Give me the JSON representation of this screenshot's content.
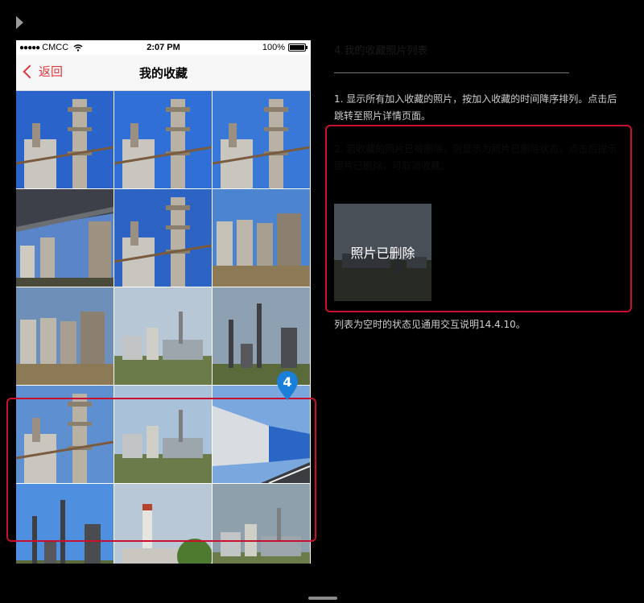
{
  "status_bar": {
    "carrier": "CMCC",
    "signal_dots": "●●●●●",
    "time": "2:07 PM",
    "battery": "100%"
  },
  "nav": {
    "back_label": "返回",
    "title": "我的收藏"
  },
  "annotation": {
    "marker_number": "4",
    "highlight_color": "#c8102e",
    "marker_color": "#1a7fd8"
  },
  "notes": {
    "heading": "4.我的收藏照片列表",
    "desc": "1. 显示所有加入收藏的照片，按加入收藏的时间降序排列。点击后跳转至照片详情页面。",
    "hidden_text": "2. 若收藏的照片已被删除，则显示为照片已删除状态，点击后提示照片已删除，可取消收藏。",
    "deleted_label": "照片已删除",
    "empty_note": "列表为空时的状态见通用交互说明14.4.10。"
  },
  "photos": [
    {
      "type": "tower",
      "sky": "#2a63c9"
    },
    {
      "type": "tower",
      "sky": "#2f6fd6"
    },
    {
      "type": "tower",
      "sky": "#3a78d8"
    },
    {
      "type": "pipes",
      "sky": "#5a86c9"
    },
    {
      "type": "tower",
      "sky": "#2d64c4"
    },
    {
      "type": "silos",
      "sky": "#4d84cf"
    },
    {
      "type": "silos",
      "sky": "#6e90b8"
    },
    {
      "type": "plant",
      "sky": "#b8c7d6"
    },
    {
      "type": "stacks",
      "sky": "#8ea1b3"
    },
    {
      "type": "tower",
      "sky": "#5e8fd0"
    },
    {
      "type": "plant",
      "sky": "#a9c2da"
    },
    {
      "type": "warehouse",
      "sky": "#7aa8de"
    },
    {
      "type": "stacks",
      "sky": "#4f8fe0"
    },
    {
      "type": "chimney",
      "sky": "#b9c8d6"
    },
    {
      "type": "plant",
      "sky": "#8fa0ad"
    }
  ]
}
